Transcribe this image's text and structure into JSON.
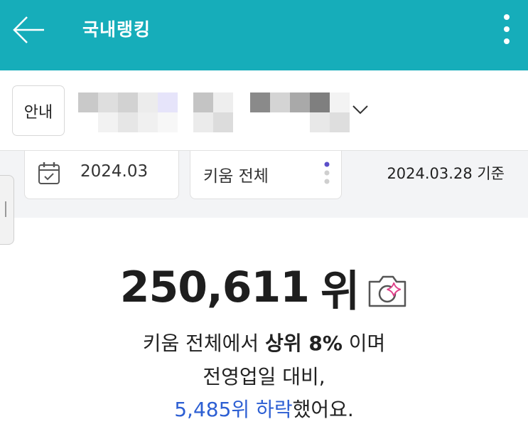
{
  "header": {
    "title": "국내랭킹",
    "background": "#16adba"
  },
  "guide": {
    "label": "안내"
  },
  "account": {
    "masked": true
  },
  "filters": {
    "date": "2024.03",
    "market": "키움 전체",
    "as_of": "2024.03.28 기준"
  },
  "ranking": {
    "rank": "250,611",
    "unit": "위",
    "line1_market": "키움 전체에서",
    "line1_top": "상위 8%",
    "line1_tail": "이며",
    "line2": "전영업일 대비,",
    "line3_change": "5,485위 하락",
    "line3_tail": "했어요.",
    "change_color": "#2d5fd3"
  },
  "icons": {
    "back": "arrow-left-icon",
    "more": "more-vertical-icon",
    "dropdown": "chevron-down-icon",
    "calendar": "calendar-icon",
    "market_menu": "dots-icon",
    "camera": "camera-sparkle-icon"
  }
}
